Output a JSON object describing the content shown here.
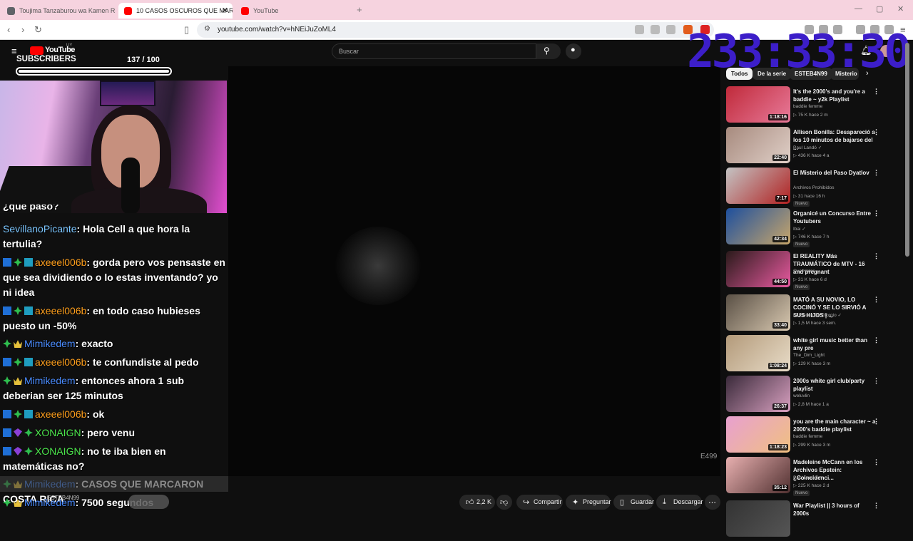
{
  "browser": {
    "tabs": [
      {
        "label": "Toujima Tanzaburou wa Kamen Ride",
        "color": "#5f6368"
      },
      {
        "label": "10 CASOS OSCUROS QUE MARC",
        "color": "#ff0000"
      },
      {
        "label": "YouTube",
        "color": "#ff0000"
      }
    ],
    "url": "youtube.com/watch?v=hNEiJuZoML4"
  },
  "youtube": {
    "logo": "YouTube",
    "logo_region": "UY",
    "search_placeholder": "Buscar"
  },
  "overlay": {
    "subs_label": "SUBSCRIBERS",
    "subs_count": "137",
    "subs_goal": "/ 100",
    "subs_progress": 1.0,
    "timer": "233:33:30",
    "video_code": "E499"
  },
  "chat": {
    "partial_top": "¿qué pasó?",
    "messages": [
      {
        "badges": [],
        "user": "SevillanoPicante",
        "color": "#7cc6ff",
        "text": ": Hola Cell a que hora la tertulia?"
      },
      {
        "badges": [
          "b-prime",
          "b-sub",
          "b-cube"
        ],
        "user": "axeeel006b",
        "color": "#ff9f1c",
        "text": ": gorda pero vos pensaste en que sea dividiendo o lo estas inventando? yo ni idea"
      },
      {
        "badges": [
          "b-prime",
          "b-sub",
          "b-cube"
        ],
        "user": "axeeel006b",
        "color": "#ff9f1c",
        "text": ": en todo caso hubieses puesto un -50%"
      },
      {
        "badges": [
          "b-sub",
          "b-crown"
        ],
        "user": "Mimikedem",
        "color": "#4a8cff",
        "text": ": exacto"
      },
      {
        "badges": [
          "b-prime",
          "b-sub",
          "b-cube"
        ],
        "user": "axeeel006b",
        "color": "#ff9f1c",
        "text": ": te confundiste al pedo"
      },
      {
        "badges": [
          "b-sub",
          "b-crown"
        ],
        "user": "Mimikedem",
        "color": "#4a8cff",
        "text": ": entonces ahora 1 sub deberian ser 125 minutos"
      },
      {
        "badges": [
          "b-prime",
          "b-sub",
          "b-cube"
        ],
        "user": "axeeel006b",
        "color": "#ff9f1c",
        "text": ": ok"
      },
      {
        "badges": [
          "b-prime",
          "b-gem",
          "b-sub"
        ],
        "user": "XONAIGN",
        "color": "#4de84d",
        "text": ": pero venu"
      },
      {
        "badges": [
          "b-prime",
          "b-gem",
          "b-sub"
        ],
        "user": "XONAIGN",
        "color": "#4de84d",
        "text": ": no te iba bien en matemáticas no?"
      },
      {
        "badges": [
          "b-sub",
          "b-crown"
        ],
        "user": "Mimikedem",
        "color": "#4a8cff",
        "text": ": CASOS QUE MARCARON COSTA RICA"
      },
      {
        "badges": [
          "b-sub",
          "b-crown"
        ],
        "user": "Mimikedem",
        "color": "#4a8cff",
        "text": ": 7500 segundos"
      }
    ],
    "pinned_author": "ESTEB4N99"
  },
  "actions": {
    "likes": "2,2 K",
    "share": "Compartir",
    "ask": "Preguntar",
    "save": "Guardar",
    "download": "Descargar"
  },
  "chips": [
    "Todos",
    "De la serie",
    "ESTEB4N99",
    "Misterio"
  ],
  "sidebar": [
    {
      "title": "It's the 2000's and you're a baddie ~ y2k Playlist",
      "channel": "baddie femme",
      "meta": "▷ 75 K   hace 2 m",
      "dur": "1:18:16",
      "colors": [
        "#c02a3a",
        "#e87a9a"
      ],
      "new": ""
    },
    {
      "title": "Allison Bonilla: Desapareció a los 10 minutos de bajarse del ...",
      "channel": "Paul Landó ✓",
      "meta": "▷ 436 K   hace 4 a",
      "dur": "22:40",
      "colors": [
        "#a78a7e",
        "#e0d0c8"
      ],
      "new": ""
    },
    {
      "title": "El Misterio del Paso Dyatlov",
      "channel": "Archivos Prohibidos",
      "meta": "▷ 31   hace 16 h",
      "dur": "7:17",
      "colors": [
        "#c4c4c4",
        "#b02020"
      ],
      "new": "Nuevo"
    },
    {
      "title": "Organicé un Concurso Entre Youtubers",
      "channel": "Ibai ✓",
      "meta": "▷ 746 K   hace 7 h",
      "dur": "42:34",
      "colors": [
        "#1d4f9e",
        "#c8a66a"
      ],
      "new": "Nuevo"
    },
    {
      "title": "El REALITY Más TRAUMÁTICO de MTV - 16 and pregnant",
      "channel": "Que Hater",
      "meta": "▷ 31 K   hace 6 d",
      "dur": "44:50",
      "colors": [
        "#2a1a1a",
        "#e85aa0"
      ],
      "new": "Nuevo"
    },
    {
      "title": "MATÓ A SU NOVIO, LO COCINÓ Y SE LO SIRVIÓ A SUS HIJOS | ...",
      "channel": "El Rincón De Giorgio ✓",
      "meta": "▷ 1,5 M   hace 3 sem.",
      "dur": "33:40",
      "colors": [
        "#5a5045",
        "#d8c8b0"
      ],
      "new": ""
    },
    {
      "title": "white girl music better than any pre",
      "channel": "The_Dim_Light",
      "meta": "▷ 129 K   hace 3 m",
      "dur": "1:08:24",
      "colors": [
        "#b39a7a",
        "#e8dcc8"
      ],
      "new": ""
    },
    {
      "title": "2000s white girl club/party playlist",
      "channel": "weluvlin",
      "meta": "▷ 2,8 M   hace 1 a",
      "dur": "26:37",
      "colors": [
        "#3a2a3a",
        "#d8a0c0"
      ],
      "new": ""
    },
    {
      "title": "you are the main character ~ a 2000's baddie playlist",
      "channel": "baddie femme",
      "meta": "▷ 299 K   hace 3 m",
      "dur": "1:18:23",
      "colors": [
        "#e8a0d0",
        "#f0c080"
      ],
      "new": ""
    },
    {
      "title": "Madeleine McCann en los Archivos Epstein: ¿Coincidenci...",
      "channel": "Paul Landó ✓",
      "meta": "▷ 225 K   hace 2 d",
      "dur": "35:12",
      "colors": [
        "#e8b0b0",
        "#503030"
      ],
      "new": "Nuevo"
    },
    {
      "title": "War Playlist || 3 hours of 2000s",
      "channel": "",
      "meta": "",
      "dur": "",
      "colors": [
        "#333",
        "#555"
      ],
      "new": ""
    }
  ]
}
